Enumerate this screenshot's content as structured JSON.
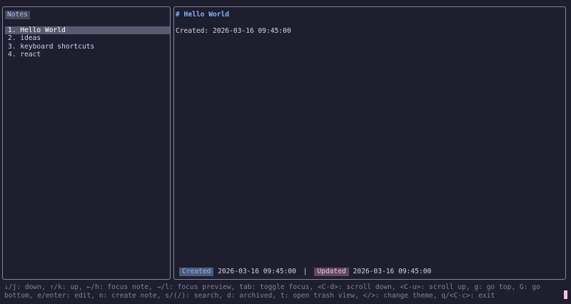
{
  "notes_panel": {
    "title": "Notes",
    "items": [
      {
        "label": "1. Hello World",
        "selected": true
      },
      {
        "label": "2. ideas",
        "selected": false
      },
      {
        "label": "3. keyboard shortcuts",
        "selected": false
      },
      {
        "label": "4. react",
        "selected": false
      }
    ]
  },
  "preview": {
    "heading": "# Hello World",
    "body_line": "Created: 2026-03-16 09:45:00",
    "meta": {
      "created_label": "Created",
      "created_value": "2026-03-16 09:45:00",
      "separator": "|",
      "updated_label": "Updated",
      "updated_value": "2026-03-16 09:45:00"
    }
  },
  "help_bar": {
    "text": "↓/j: down, ↑/k: up, ←/h: focus note, →/l: focus preview, tab: toggle focus, <C-d>: scroll down, <C-u>: scroll up, g: go top, G: go bottom, e/enter: edit, n: create note, s/(/): search, d: archived, t: open trash view, </>: change theme, q/<C-c>: exit"
  },
  "colors": {
    "background": "#1e1e2e",
    "border": "#7f849c",
    "heading": "#89b4fa",
    "selection": "#585b70",
    "cursor": "#f5c2e7"
  }
}
